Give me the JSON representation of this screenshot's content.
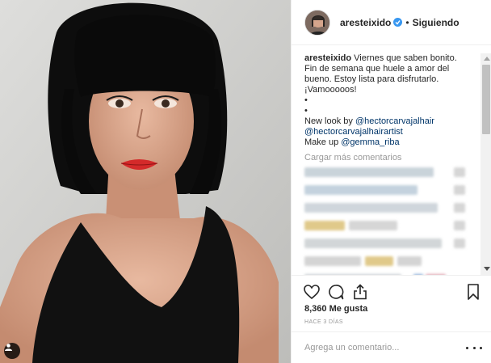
{
  "header": {
    "username": "aresteixido",
    "separator": "•",
    "follow_status": "Siguiendo"
  },
  "caption": {
    "username": "aresteixido",
    "text": "Viernes que saben bonito. Fin de semana que huele a amor del bueno. Estoy lista para disfrutarlo. ¡Vamooooos!",
    "dot1": "•",
    "dot2": "•",
    "new_look_prefix": "New look by",
    "new_look_handle": "@hectorcarvajalhair",
    "handle2": "@hectorcarvajalhairartist",
    "makeup_prefix": "Make up",
    "makeup_handle": "@gemma_riba"
  },
  "load_more": "Cargar más comentarios",
  "actions": {
    "like_icon": "heart-icon",
    "comment_icon": "comment-icon",
    "share_icon": "share-icon",
    "save_icon": "bookmark-icon"
  },
  "likes": "8,360 Me gusta",
  "timestamp": "HACE 3 DÍAS",
  "comment_box": {
    "placeholder": "Agrega un comentario...",
    "more_icon": "more-options-icon"
  },
  "colors": {
    "link": "#003569",
    "muted": "#999999",
    "verified": "#3897f0",
    "text": "#262626"
  }
}
